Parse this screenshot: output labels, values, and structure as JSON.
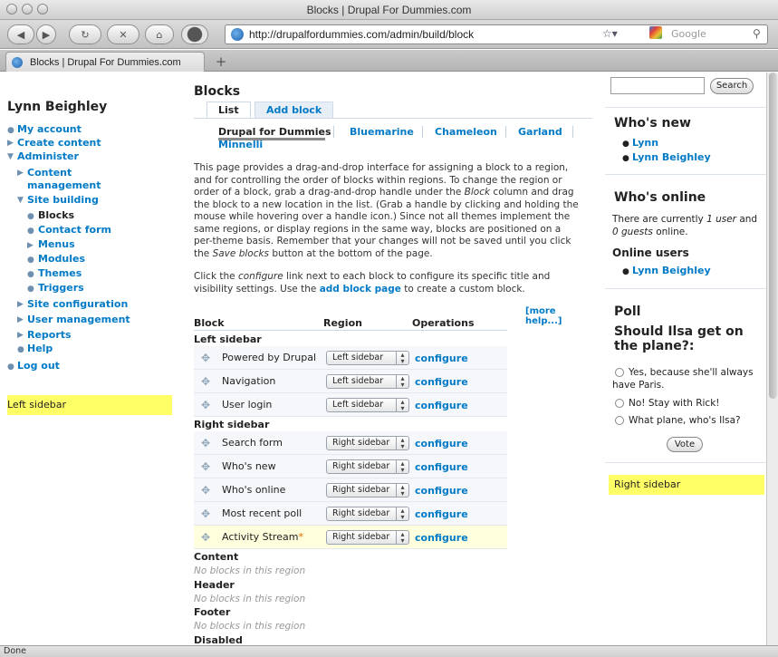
{
  "window": {
    "title": "Blocks | Drupal For Dummies.com",
    "url": "http://drupalfordummies.com/admin/build/block",
    "search_placeholder": "Google",
    "tab_label": "Blocks | Drupal For Dummies.com",
    "new_tab": "+",
    "status": "Done"
  },
  "left": {
    "user_name": "Lynn Beighley",
    "nav": {
      "my_account": "My account",
      "create_content": "Create content",
      "administer": "Administer",
      "content_management_1": "Content",
      "content_management_2": "management",
      "site_building": "Site building",
      "blocks": "Blocks",
      "contact_form": "Contact form",
      "menus": "Menus",
      "modules": "Modules",
      "themes": "Themes",
      "triggers": "Triggers",
      "site_configuration": "Site configuration",
      "user_management": "User management",
      "reports": "Reports",
      "help": "Help",
      "log_out": "Log out"
    },
    "region_label": "Left sidebar"
  },
  "main": {
    "title": "Blocks",
    "tabs": {
      "list": "List",
      "add_block": "Add block"
    },
    "themes": {
      "drupal_for_dummies": "Drupal for Dummies",
      "bluemarine": "Bluemarine",
      "chameleon": "Chameleon",
      "garland": "Garland",
      "minnelli": "Minnelli"
    },
    "intro": {
      "l1": "This page provides a drag-and-drop interface for assigning a block to a region,",
      "l2": "and for controlling the order of blocks within regions. To change the region or",
      "l3a": "order of a block, grab a drag-and-drop handle under the ",
      "l3b": "Block",
      "l3c": " column and drag",
      "l4": "the block to a new location in the list. (Grab a handle by clicking and holding the",
      "l5": "mouse while hovering over a handle icon.) Since not all themes implement the",
      "l6": "same regions, or display regions in the same way, blocks are positioned on a",
      "l7": "per-theme basis. Remember that your changes will not be saved until you click",
      "l8a": "the ",
      "l8b": "Save blocks",
      "l8c": " button at the bottom of the page."
    },
    "configure_para": {
      "l1a": "Click the ",
      "l1b": "configure",
      "l1c": " link next to each block to configure its specific title and",
      "l2a": "visibility settings. Use the ",
      "l2b": "add block page",
      "l2c": " to create a custom block."
    },
    "more_help": "[more help...]",
    "table": {
      "headers": {
        "block": "Block",
        "region": "Region",
        "operations": "Operations"
      },
      "configure": "configure",
      "left_sidebar": "Left sidebar",
      "right_sidebar": "Right sidebar",
      "left_blocks": [
        "Powered by Drupal",
        "Navigation",
        "User login"
      ],
      "right_blocks": [
        "Search form",
        "Who's new",
        "Who's online",
        "Most recent poll",
        "Activity Stream"
      ],
      "changed_marker": "*",
      "content": "Content",
      "header": "Header",
      "footer": "Footer",
      "disabled": "Disabled",
      "no_blocks": "No blocks in this region"
    }
  },
  "right": {
    "search_button": "Search",
    "whos_new_title": "Who's new",
    "whos_new": [
      "Lynn",
      "Lynn Beighley"
    ],
    "whos_online_title": "Who's online",
    "online_text_1": "There are currently ",
    "online_users_count": "1 user",
    "online_text_2": " and",
    "online_guests": "0 guests",
    "online_text_3": " online.",
    "online_users_title": "Online users",
    "online_user": "Lynn Beighley",
    "poll_title": "Poll",
    "poll_question_1": "Should Ilsa get on",
    "poll_question_2": "the plane?:",
    "poll_options": {
      "o1a": "Yes, because she'll always",
      "o1b": "have Paris.",
      "o2": "No! Stay with Rick!",
      "o3": "What plane, who's Ilsa?"
    },
    "vote_button": "Vote",
    "region_label": "Right sidebar"
  },
  "colors": {
    "link": "#027ac6",
    "region_highlight": "#ffff66",
    "changed_row": "#ffffdd"
  }
}
